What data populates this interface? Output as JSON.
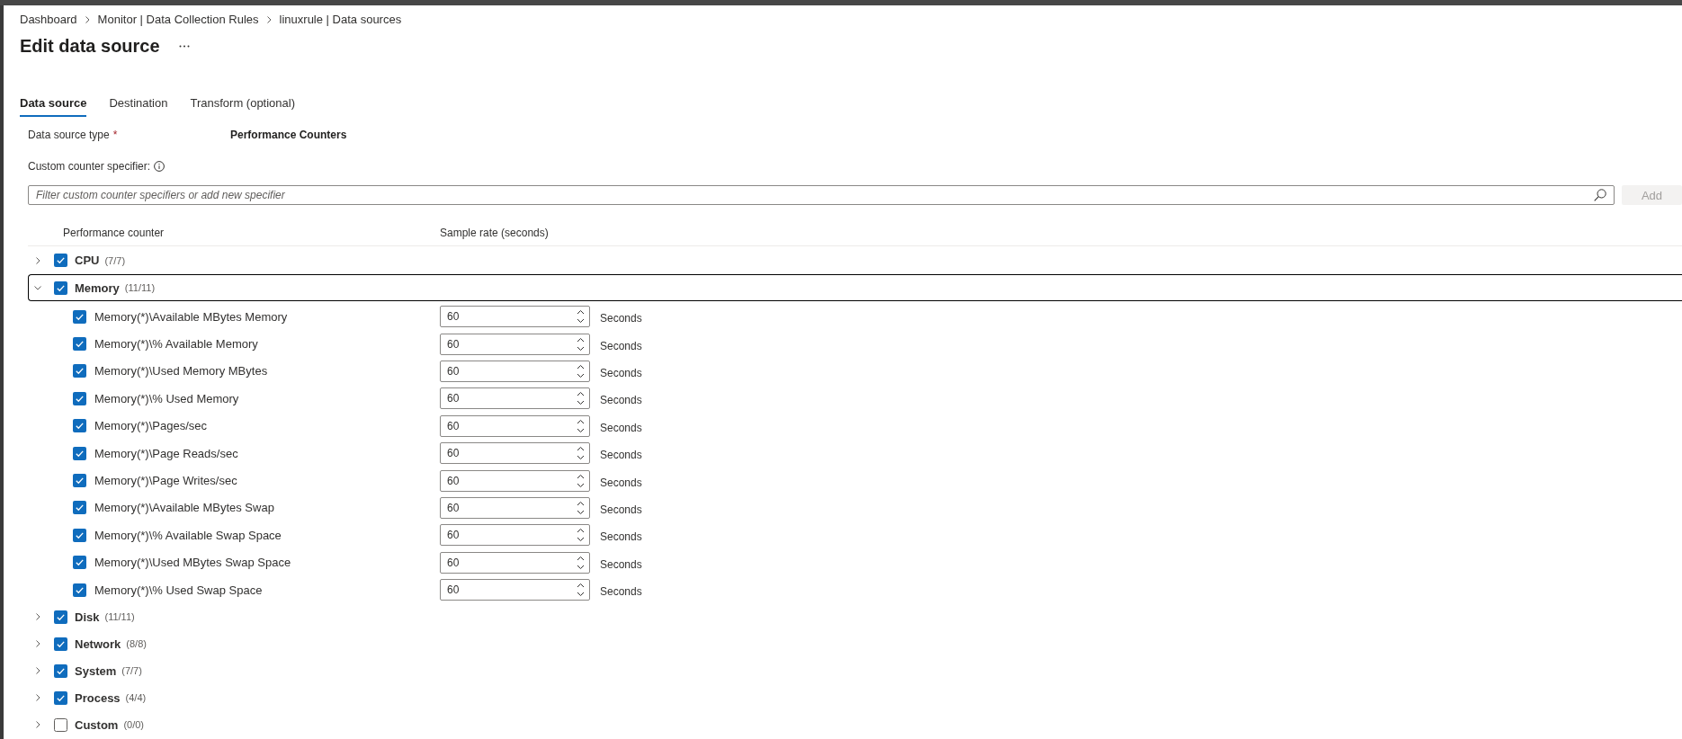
{
  "breadcrumbs": [
    "Dashboard",
    "Monitor | Data Collection Rules",
    "linuxrule | Data sources"
  ],
  "title": "Edit data source",
  "tabs": [
    {
      "label": "Data source",
      "selected": true
    },
    {
      "label": "Destination",
      "selected": false
    },
    {
      "label": "Transform (optional)",
      "selected": false
    }
  ],
  "data_source_type": {
    "label": "Data source type",
    "required_mark": "*",
    "value": "Performance Counters"
  },
  "custom_counter": {
    "label": "Custom counter specifier:",
    "search": {
      "placeholder": "Filter custom counter specifiers or add new specifier"
    },
    "add_button": {
      "label": "Add",
      "disabled": true
    }
  },
  "table": {
    "columns": [
      "Performance counter",
      "Sample rate (seconds)"
    ],
    "groups": [
      {
        "name": "CPU",
        "count": "(7/7)",
        "checked": true,
        "expanded": false,
        "focused": false
      },
      {
        "name": "Memory",
        "count": "(11/11)",
        "checked": true,
        "expanded": true,
        "focused": true,
        "children": [
          {
            "name": "Memory(*)\\Available MBytes Memory",
            "checked": true,
            "rate": "60",
            "unit": "Seconds"
          },
          {
            "name": "Memory(*)\\% Available Memory",
            "checked": true,
            "rate": "60",
            "unit": "Seconds"
          },
          {
            "name": "Memory(*)\\Used Memory MBytes",
            "checked": true,
            "rate": "60",
            "unit": "Seconds"
          },
          {
            "name": "Memory(*)\\% Used Memory",
            "checked": true,
            "rate": "60",
            "unit": "Seconds"
          },
          {
            "name": "Memory(*)\\Pages/sec",
            "checked": true,
            "rate": "60",
            "unit": "Seconds"
          },
          {
            "name": "Memory(*)\\Page Reads/sec",
            "checked": true,
            "rate": "60",
            "unit": "Seconds"
          },
          {
            "name": "Memory(*)\\Page Writes/sec",
            "checked": true,
            "rate": "60",
            "unit": "Seconds"
          },
          {
            "name": "Memory(*)\\Available MBytes Swap",
            "checked": true,
            "rate": "60",
            "unit": "Seconds"
          },
          {
            "name": "Memory(*)\\% Available Swap Space",
            "checked": true,
            "rate": "60",
            "unit": "Seconds"
          },
          {
            "name": "Memory(*)\\Used MBytes Swap Space",
            "checked": true,
            "rate": "60",
            "unit": "Seconds"
          },
          {
            "name": "Memory(*)\\% Used Swap Space",
            "checked": true,
            "rate": "60",
            "unit": "Seconds"
          }
        ]
      },
      {
        "name": "Disk",
        "count": "(11/11)",
        "checked": true,
        "expanded": false,
        "focused": false
      },
      {
        "name": "Network",
        "count": "(8/8)",
        "checked": true,
        "expanded": false,
        "focused": false
      },
      {
        "name": "System",
        "count": "(7/7)",
        "checked": true,
        "expanded": false,
        "focused": false
      },
      {
        "name": "Process",
        "count": "(4/4)",
        "checked": true,
        "expanded": false,
        "focused": false
      },
      {
        "name": "Custom",
        "count": "(0/0)",
        "checked": false,
        "expanded": false,
        "focused": false
      }
    ]
  }
}
